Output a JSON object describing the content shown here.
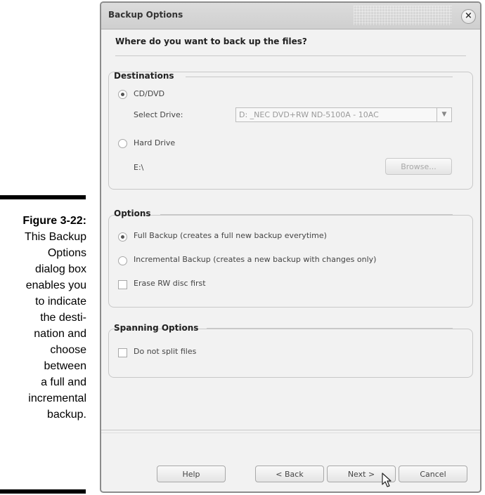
{
  "figure": {
    "number": "Figure 3-22:",
    "caption": "This Backup\nOptions\ndialog box\nenables you\nto indicate\nthe desti-\nnation and\nchoose\nbetween\na full and\nincremental\nbackup."
  },
  "dialog": {
    "title": "Backup Options",
    "close_label": "×",
    "question": "Where do you want to back up the files?"
  },
  "destinations": {
    "title": "Destinations",
    "cd_dvd_label": "CD/DVD",
    "cd_dvd_selected": true,
    "select_drive_label": "Select Drive:",
    "select_drive_value": "D: _NEC DVD+RW ND-5100A - 10AC",
    "dropdown_arrow": "▼",
    "hard_drive_label": "Hard Drive",
    "hard_drive_selected": false,
    "hard_drive_path": "E:\\",
    "browse_label": "Browse..."
  },
  "options": {
    "title": "Options",
    "full_backup_label": "Full Backup (creates a full new backup everytime)",
    "full_backup_selected": true,
    "incremental_backup_label": "Incremental Backup (creates a new backup with changes only)",
    "incremental_backup_selected": false,
    "erase_rw_label": "Erase RW disc first",
    "erase_rw_checked": false
  },
  "spanning": {
    "title": "Spanning Options",
    "no_split_label": "Do not split files",
    "no_split_checked": false
  },
  "buttons": {
    "help": "Help",
    "back": "< Back",
    "next": "Next >",
    "cancel": "Cancel"
  },
  "icons": {
    "cursor": "mouse-pointer-icon"
  }
}
